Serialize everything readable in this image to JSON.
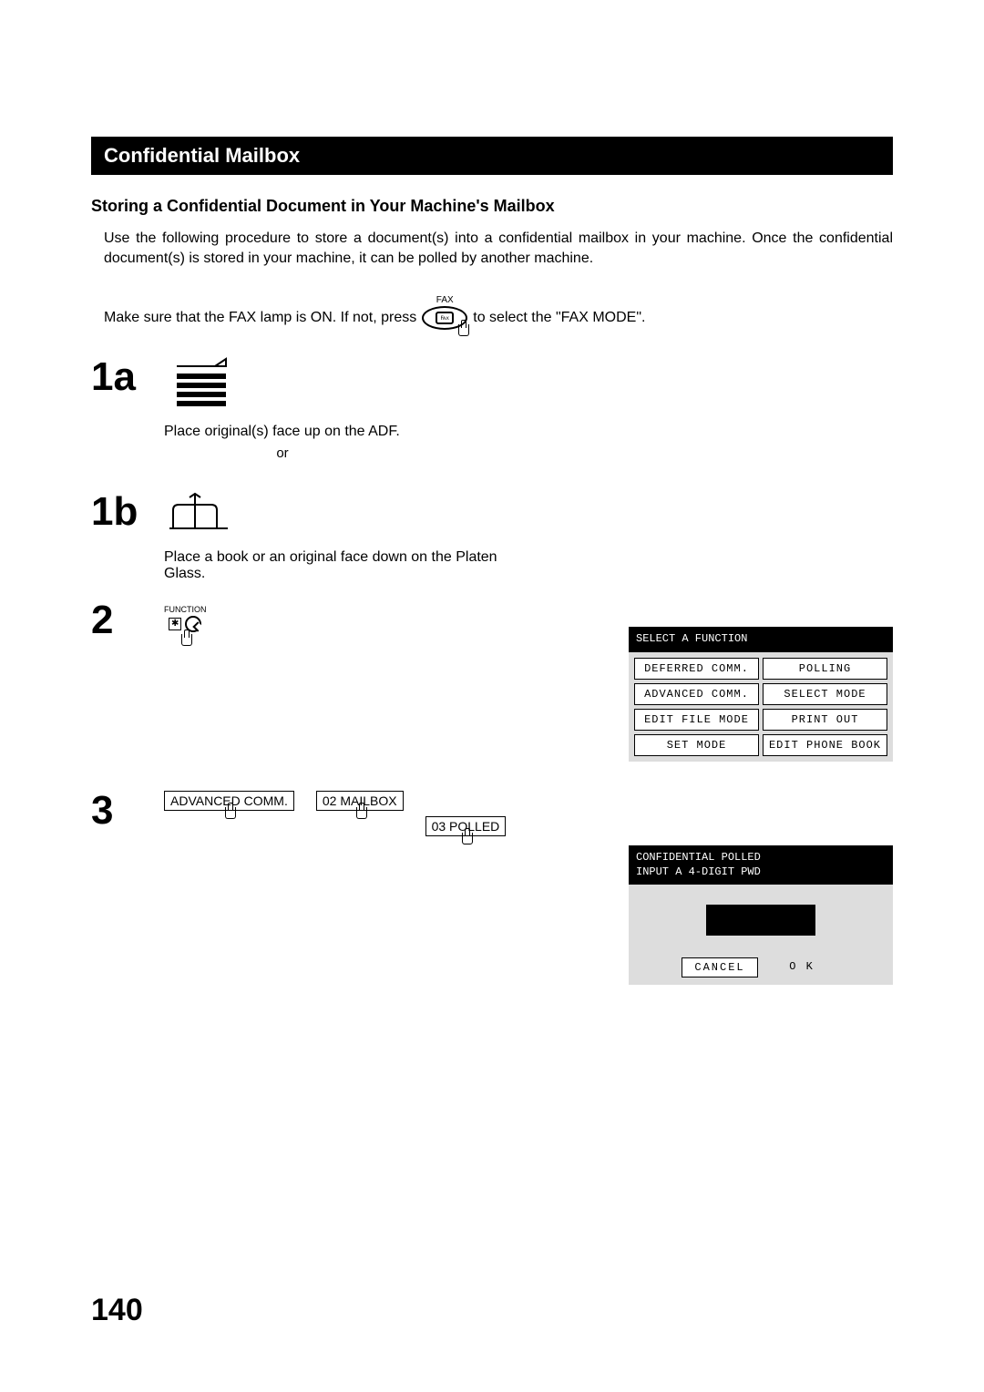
{
  "section_title": "Confidential Mailbox",
  "subheading": "Storing a Confidential Document in Your Machine's Mailbox",
  "intro": "Use the following procedure to store a document(s) into a confidential mailbox in your machine.  Once the confidential document(s) is stored in your machine, it can be polled by another machine.",
  "fax_line_pre": "Make sure that the FAX lamp is ON.  If not, press",
  "fax_btn_top_label": "FAX",
  "fax_line_post": "to select the \"FAX MODE\".",
  "steps": {
    "s1a": {
      "num": "1a",
      "text": "Place original(s) face up on the ADF."
    },
    "or": "or",
    "s1b": {
      "num": "1b",
      "text": "Place a book or an original face down on the Platen Glass."
    },
    "s2": {
      "num": "2",
      "func_label": "FUNCTION"
    },
    "s3": {
      "num": "3",
      "buttons": {
        "b1": "ADVANCED COMM.",
        "b2": "02 MAILBOX",
        "b3": "03 POLLED"
      }
    }
  },
  "panel1": {
    "header": "SELECT A FUNCTION",
    "cells": {
      "c1": "DEFERRED COMM.",
      "c2": "POLLING",
      "c3": "ADVANCED COMM.",
      "c4": "SELECT MODE",
      "c5": "EDIT FILE MODE",
      "c6": "PRINT OUT",
      "c7": "SET MODE",
      "c8": "EDIT PHONE BOOK"
    }
  },
  "panel2": {
    "header_l1": "CONFIDENTIAL POLLED",
    "header_l2": "INPUT A 4-DIGIT PWD",
    "cancel": "CANCEL",
    "ok": "O K"
  },
  "page_number": "140"
}
